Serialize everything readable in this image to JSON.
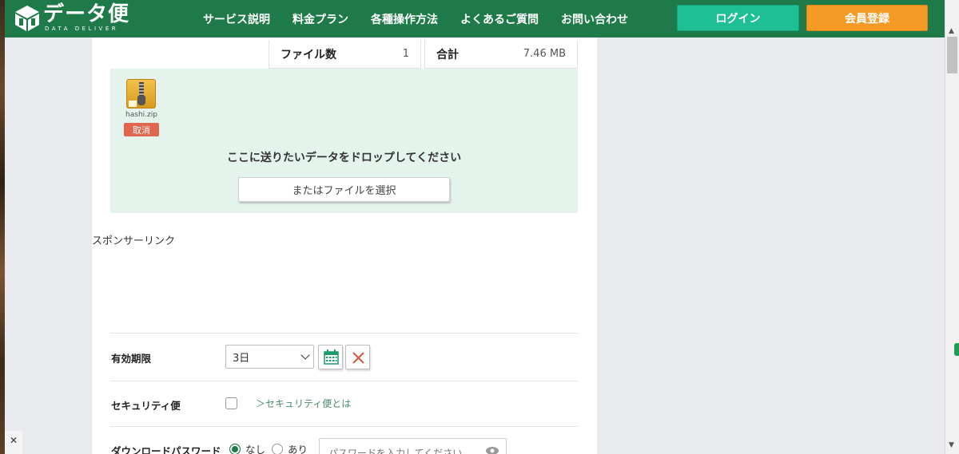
{
  "header": {
    "logo_title": "データ便",
    "logo_sub": "DATA DELIVER",
    "nav": [
      "サービス説明",
      "料金プラン",
      "各種操作方法",
      "よくあるご質問",
      "お問い合わせ"
    ],
    "login_label": "ログイン",
    "register_label": "会員登録"
  },
  "stats": {
    "file_count_label": "ファイル数",
    "file_count_value": "1",
    "total_label": "合計",
    "total_value": "7.46 MB"
  },
  "dropzone": {
    "file_name": "hashi.zip",
    "cancel_label": "取消",
    "drop_text": "ここに送りたいデータをドロップしてください",
    "choose_label": "またはファイルを選択"
  },
  "sponsor_label": "スポンサーリンク",
  "form": {
    "expiry_label": "有効期限",
    "expiry_value": "3日",
    "security_label": "セキュリティ便",
    "security_link": "＞セキュリティ便とは",
    "password_label": "ダウンロードパスワード",
    "password_none": "なし",
    "password_yes": "あり",
    "password_placeholder": "パスワードを入力してください"
  },
  "colors": {
    "header_bg": "#1f7a4a",
    "login_bg": "#1fbf95",
    "register_bg": "#f59a25",
    "dropzone_bg": "#e4f4ec",
    "cancel_bg": "#e0664f"
  }
}
